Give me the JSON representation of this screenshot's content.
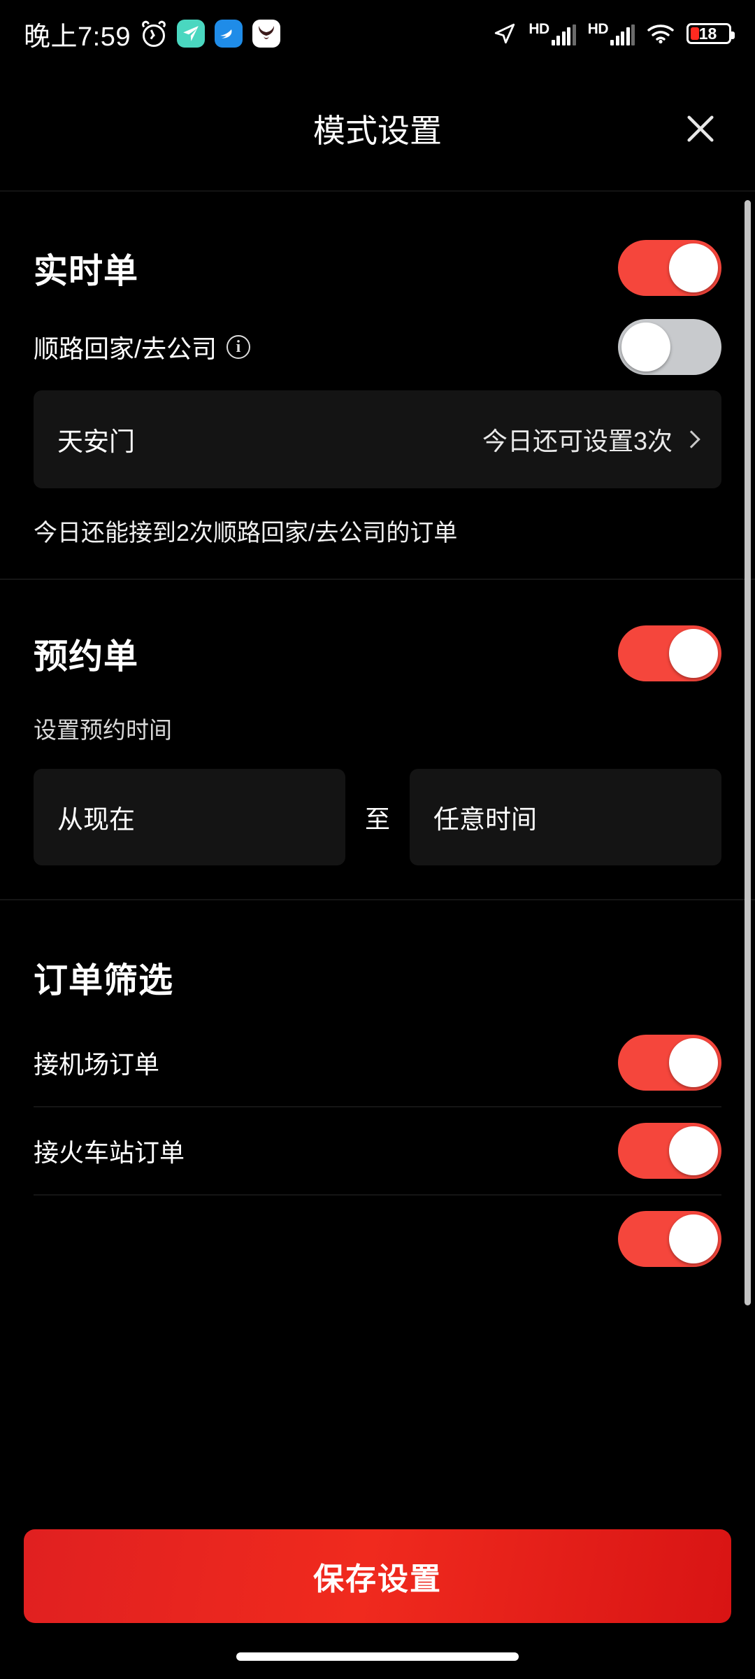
{
  "status_bar": {
    "time": "晚上7:59",
    "alarm_icon": "alarm-clock-icon",
    "app_icons": [
      "paper-plane-app-icon",
      "wing-app-icon",
      "horns-app-icon"
    ],
    "location_icon": "location-arrow-icon",
    "network_labels": [
      "HD",
      "HD"
    ],
    "wifi_icon": "wifi-icon",
    "battery_level": "18"
  },
  "header": {
    "title": "模式设置",
    "close_label": "×"
  },
  "realtime_section": {
    "title": "实时单",
    "toggle_state": "on",
    "subrow_label": "顺路回家/去公司",
    "subrow_info_icon": "info-icon",
    "subrow_toggle_state": "off",
    "location_name": "天安门",
    "location_count": "今日还可设置3次",
    "hint": "今日还能接到2次顺路回家/去公司的订单"
  },
  "reservation_section": {
    "title": "预约单",
    "toggle_state": "on",
    "time_label": "设置预约时间",
    "time_from": "从现在",
    "time_separator": "至",
    "time_to": "任意时间"
  },
  "filter_section": {
    "title": "订单筛选",
    "rows": [
      {
        "label": "接机场订单",
        "toggle_state": "on"
      },
      {
        "label": "接火车站订单",
        "toggle_state": "on"
      },
      {
        "label": "",
        "toggle_state": "on"
      }
    ]
  },
  "bottom": {
    "save_label": "保存设置"
  },
  "colors": {
    "accent_red": "#f5463c",
    "toggle_off": "#c8cacd",
    "card_bg": "#141414",
    "background": "#000000",
    "battery_red": "#ff2a20"
  }
}
